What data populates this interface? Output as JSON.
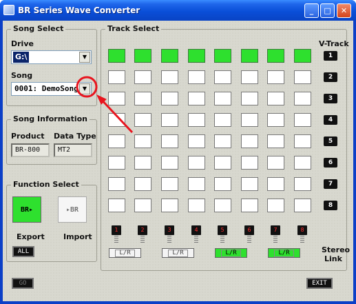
{
  "window": {
    "title": "BR Series Wave Converter"
  },
  "song_select": {
    "group_title": "Song Select",
    "drive_label": "Drive",
    "drive_value": "G:\\",
    "song_label": "Song",
    "song_value": "0001: DemoSong"
  },
  "song_info": {
    "group_title": "Song Information",
    "product_label": "Product",
    "product_value": "BR-800",
    "data_type_label": "Data Type",
    "data_type_value": "MT2"
  },
  "function_select": {
    "group_title": "Function Select",
    "export_icon_text": "BR▸",
    "import_icon_text": "▸BR",
    "export_label": "Export",
    "import_label": "Import",
    "all_label": "ALL"
  },
  "track_select": {
    "group_title": "Track Select",
    "vtrack_label": "V-Track",
    "vtracks": [
      "1",
      "2",
      "3",
      "4",
      "5",
      "6",
      "7",
      "8"
    ],
    "tracks": [
      "1",
      "2",
      "3",
      "4",
      "5",
      "6",
      "7",
      "8"
    ],
    "selected_row": 1,
    "stereo_link_label": "Stereo Link",
    "lr_label": "L/R",
    "stereo_links": [
      false,
      false,
      true,
      true
    ]
  },
  "footer": {
    "go_label": "GO",
    "exit_label": "EXIT"
  },
  "colors": {
    "selected": "#2ee02e",
    "annotation": "#e8141e"
  }
}
